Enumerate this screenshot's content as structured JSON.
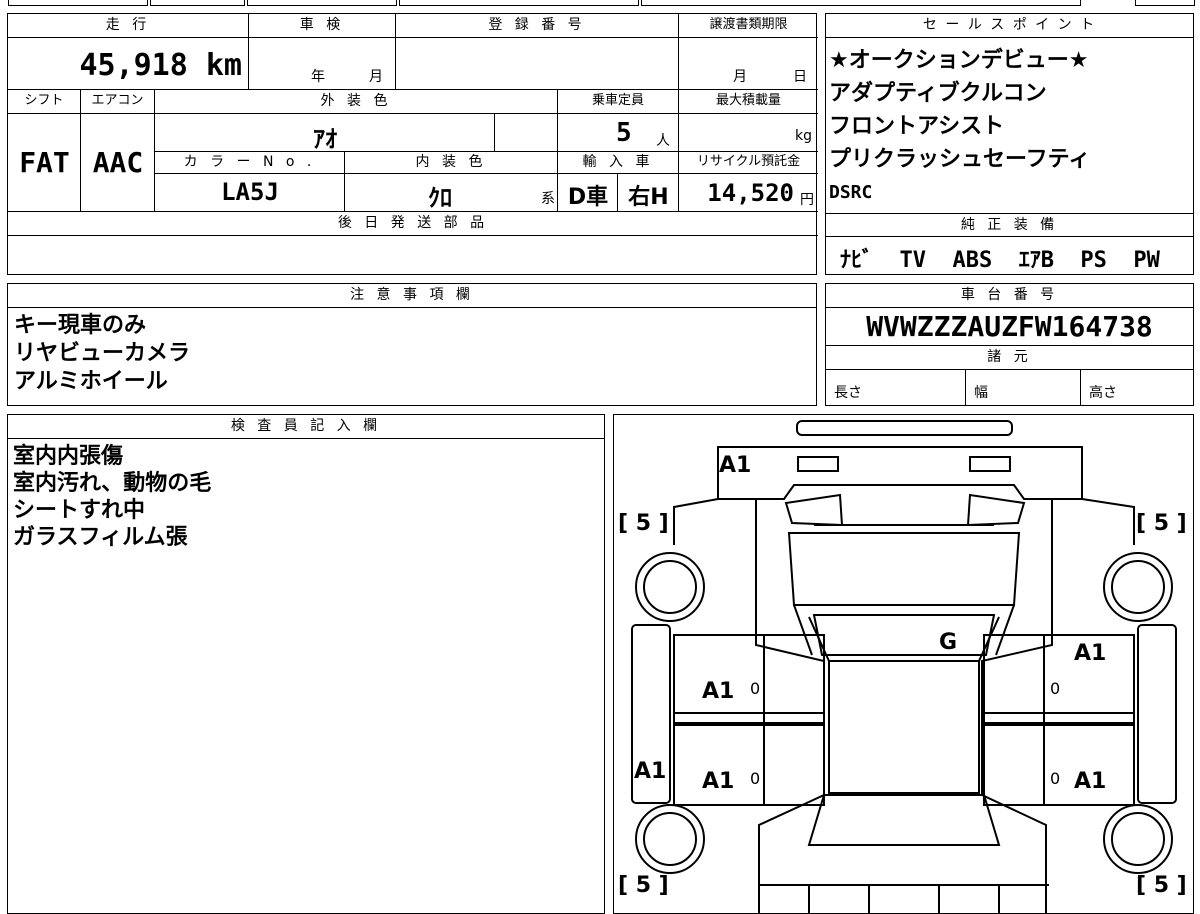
{
  "labels": {
    "mileage": "走 行",
    "inspection": "車 検",
    "registration": "登 録 番 号",
    "transfer_deadline": "譲渡書類期限",
    "sales_points": "セ ー ル ス ポ イ ン ト",
    "shift": "シフト",
    "aircon": "エアコン",
    "exterior_color": "外 装 色",
    "capacity": "乗車定員",
    "max_load": "最大積載量",
    "color_no": "カ ラ ー N o .",
    "interior_color": "内 装 色",
    "import": "輸 入 車",
    "recycle_fee": "リサイクル預託金",
    "later_shipping": "後 日 発 送 部 品",
    "equipment": "純 正 装 備",
    "notes": "注 意 事 項 欄",
    "chassis_no": "車 台 番 号",
    "specs": "諸 元",
    "length": "長さ",
    "width": "幅",
    "height": "高さ",
    "inspector": "検 査 員 記 入 欄",
    "year_unit": "年",
    "month_unit": "月",
    "day_unit": "日",
    "person_unit": "人",
    "kg_unit": "kg",
    "yen_unit": "円",
    "kei_unit": "系"
  },
  "values": {
    "mileage": "45,918 km",
    "shift": "FAT",
    "aircon": "AAC",
    "exterior_color": "ｱｵ",
    "capacity": "5",
    "color_no": "LA5J",
    "interior_color": "ｸﾛ",
    "import_drive": "D車",
    "import_handle": "右H",
    "recycle_fee": "14,520",
    "equipment": "ﾅﾋﾞ  TV  ABS  ｴｱB  PS  PW",
    "chassis_no": "WVWZZZAUZFW164738"
  },
  "sales_points": [
    "★オークションデビュー★",
    "アダプティブクルコン",
    "フロントアシスト",
    "プリクラッシュセーフティ",
    "DSRC"
  ],
  "notes": [
    "キー現車のみ",
    "リヤビューカメラ",
    "アルミホイール"
  ],
  "inspector_notes": [
    "室内内張傷",
    "室内汚れ、動物の毛",
    "シートすれ中",
    "ガラスフィルム張"
  ],
  "diagram": {
    "marks": {
      "a1_top": "A1",
      "g_center": "G",
      "a1_right_front": "A1",
      "a1_left_mid": "A1",
      "a1_left_lower": "A1",
      "a1_left_side": "A1",
      "a1_right_lower": "A1",
      "zero_1": "0",
      "zero_2": "0",
      "zero_3": "0",
      "zero_4": "0"
    },
    "tires": {
      "front_left": "[ 5 ]",
      "front_right": "[ 5 ]",
      "rear_left": "[ 5 ]",
      "rear_right": "[ 5 ]"
    }
  }
}
